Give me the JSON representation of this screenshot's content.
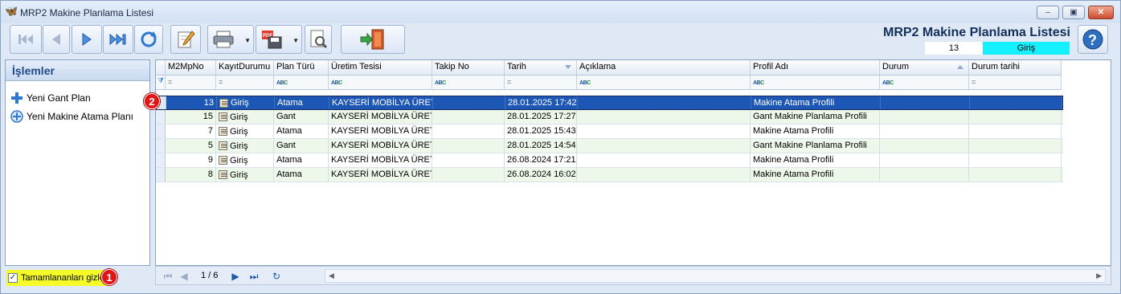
{
  "window": {
    "title": "MRP2 Makine Planlama Listesi",
    "controls": [
      "minimize",
      "maximize",
      "close"
    ]
  },
  "toolbar": {
    "buttons": [
      "first-record",
      "previous-record",
      "next-record",
      "last-record",
      "refresh",
      "edit",
      "print",
      "export-pdf",
      "tools",
      "exit"
    ]
  },
  "header": {
    "title": "MRP2 Makine Planlama Listesi",
    "record_no": "13",
    "status": "Giriş",
    "status_color": "#15f0ff"
  },
  "left_panel": {
    "title": "İşlemler",
    "items": [
      {
        "label": "Yeni Gant Plan",
        "icon": "plus-icon"
      },
      {
        "label": "Yeni Makine Atama Planı",
        "icon": "circle-plus-icon"
      }
    ],
    "hide_completed": {
      "label": "Tamamlananları gizle",
      "checked": true
    }
  },
  "annotations": [
    "1",
    "2"
  ],
  "grid": {
    "columns": [
      {
        "label": "M2MpNo",
        "sort": ""
      },
      {
        "label": "KayıtDurumu",
        "sort": ""
      },
      {
        "label": "Plan Türü",
        "sort": ""
      },
      {
        "label": "Üretim Tesisi",
        "sort": ""
      },
      {
        "label": "Takip No",
        "sort": ""
      },
      {
        "label": "Tarih",
        "sort": "desc"
      },
      {
        "label": "Açıklama",
        "sort": ""
      },
      {
        "label": "Profil Adı",
        "sort": ""
      },
      {
        "label": "Durum",
        "sort": "asc"
      },
      {
        "label": "Durum tarihi",
        "sort": ""
      }
    ],
    "filter_ops": [
      "=",
      "=",
      "ABC",
      "ABC",
      "ABC",
      "=",
      "ABC",
      "ABC",
      "ABC",
      "="
    ],
    "rows": [
      {
        "no": "13",
        "kayit": "Giriş",
        "tur": "Atama",
        "tesis": "KAYSERİ MOBİLYA ÜRETİ",
        "takip": "",
        "tarih": "28.01.2025 17:42",
        "aciklama": "",
        "profil": "Makine Atama Profili",
        "durum": "",
        "durum_tarihi": ""
      },
      {
        "no": "15",
        "kayit": "Giriş",
        "tur": "Gant",
        "tesis": "KAYSERİ MOBİLYA ÜRETİ",
        "takip": "",
        "tarih": "28.01.2025 17:27",
        "aciklama": "",
        "profil": "Gant Makine Planlama Profili",
        "durum": "",
        "durum_tarihi": ""
      },
      {
        "no": "7",
        "kayit": "Giriş",
        "tur": "Atama",
        "tesis": "KAYSERİ MOBİLYA ÜRETİ",
        "takip": "",
        "tarih": "28.01.2025 15:43",
        "aciklama": "",
        "profil": "Makine Atama Profili",
        "durum": "",
        "durum_tarihi": ""
      },
      {
        "no": "5",
        "kayit": "Giriş",
        "tur": "Gant",
        "tesis": "KAYSERİ MOBİLYA ÜRETİ",
        "takip": "",
        "tarih": "28.01.2025 14:54",
        "aciklama": "",
        "profil": "Gant Makine Planlama Profili",
        "durum": "",
        "durum_tarihi": ""
      },
      {
        "no": "9",
        "kayit": "Giriş",
        "tur": "Atama",
        "tesis": "KAYSERİ MOBİLYA ÜRETİ",
        "takip": "",
        "tarih": "26.08.2024 17:21",
        "aciklama": "",
        "profil": "Makine Atama Profili",
        "durum": "",
        "durum_tarihi": ""
      },
      {
        "no": "8",
        "kayit": "Giriş",
        "tur": "Atama",
        "tesis": "KAYSERİ MOBİLYA ÜRETİ",
        "takip": "",
        "tarih": "26.08.2024 16:02",
        "aciklama": "",
        "profil": "Makine Atama Profili",
        "durum": "",
        "durum_tarihi": ""
      }
    ],
    "selected_row": 0
  },
  "navigator": {
    "page": "1 / 6"
  },
  "colors": {
    "selection": "#1d57b5",
    "alt_row": "#edf8ea",
    "highlight_checkbox": "#f4fb29",
    "badge": "#e01515"
  }
}
